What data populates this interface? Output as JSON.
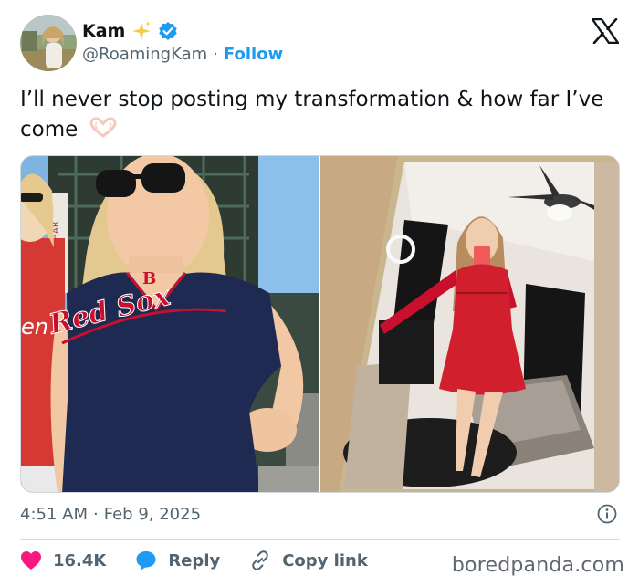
{
  "author": {
    "display_name": "Kam",
    "handle": "@RoamingKam",
    "separator": "·",
    "follow_label": "Follow",
    "verified": true
  },
  "tweet": {
    "text": "I’ll never stop posting my transformation & how far I’ve come",
    "images": [
      {
        "name": "before-photo",
        "alt": "Woman in Red Sox shirt and sunglasses at a stadium"
      },
      {
        "name": "after-photo",
        "alt": "Woman in red lace dress taking a mirror selfie"
      }
    ]
  },
  "meta": {
    "time": "4:51 AM",
    "separator": "·",
    "date": "Feb 9, 2025"
  },
  "actions": {
    "likes": "16.4K",
    "reply_label": "Reply",
    "copy_label": "Copy link"
  },
  "watermark": "boredpanda.com",
  "shirt": {
    "team_text": "Red Sox",
    "logo_letter": "B"
  },
  "colors": {
    "accent_blue": "#1d9bf0",
    "like_pink": "#f91880",
    "text_primary": "#0f1419",
    "text_secondary": "#536471",
    "border": "#cfd9de"
  },
  "icons": [
    "x-logo-icon",
    "verified-icon",
    "sparkle-icon",
    "heart-hands-icon",
    "info-icon",
    "heart-icon",
    "reply-icon",
    "link-icon"
  ]
}
